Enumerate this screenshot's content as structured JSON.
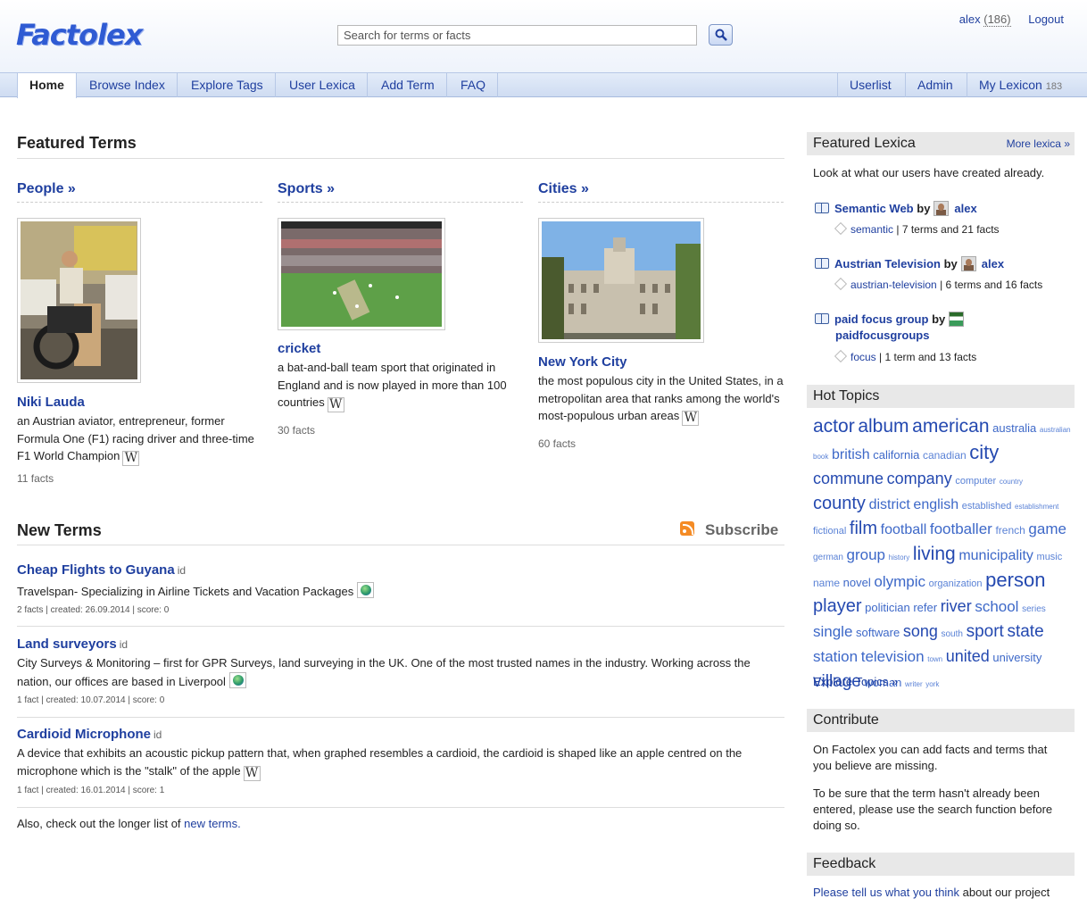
{
  "header": {
    "logo": "Factolex",
    "search_placeholder": "Search for terms or facts",
    "user": "alex",
    "user_count": "(186)",
    "logout": "Logout"
  },
  "tabs_left": [
    "Home",
    "Browse Index",
    "Explore Tags",
    "User Lexica",
    "Add Term",
    "FAQ"
  ],
  "tabs_right": {
    "userlist": "Userlist",
    "admin": "Admin",
    "my_lexicon": "My Lexicon",
    "my_lexicon_count": "183"
  },
  "featured": {
    "heading": "Featured Terms",
    "columns": [
      {
        "category": "People »",
        "term": "Niki Lauda",
        "desc": "an Austrian aviator, entrepreneur, former Formula One (F1) racing driver and three-time F1 World Champion",
        "facts": "11 facts"
      },
      {
        "category": "Sports »",
        "term": "cricket",
        "desc": "a bat-and-ball team sport that originated in England and is now played in more than 100 countries",
        "facts": "30 facts"
      },
      {
        "category": "Cities »",
        "term": "New York City",
        "desc": "the most populous city in the United States, in a metropolitan area that ranks among the world's most-populous urban areas",
        "facts": "60 facts"
      }
    ]
  },
  "new_terms": {
    "heading": "New Terms",
    "subscribe": "Subscribe",
    "id_label": "id",
    "items": [
      {
        "title": "Cheap Flights to Guyana",
        "desc": "Travelspan- Specializing in Airline Tickets and Vacation Packages",
        "meta": "2 facts | created: 26.09.2014 | score: 0"
      },
      {
        "title": "Land surveyors",
        "desc": "City Surveys & Monitoring – first for GPR Surveys, land surveying in the UK. One of the most trusted names in the industry. Working across the nation, our offices are based in Liverpool",
        "meta": "1 fact | created: 10.07.2014 | score: 0"
      },
      {
        "title": "Cardioid Microphone",
        "desc": "A device that exhibits an acoustic pickup pattern that, when graphed resembles a cardioid, the cardioid is shaped like an apple centred on the microphone which is the \"stalk\" of the apple",
        "meta": "1 fact | created: 16.01.2014 | score: 1"
      }
    ],
    "footer_text": "Also, check out the longer list of",
    "footer_link": "new terms."
  },
  "sidebar": {
    "featured_lexica": {
      "heading": "Featured Lexica",
      "more": "More lexica »",
      "intro": "Look at what our users have created already.",
      "by": "by",
      "items": [
        {
          "title": "Semantic Web",
          "user": "alex",
          "tag": "semantic",
          "stats": "| 7 terms and 21 facts"
        },
        {
          "title": "Austrian Television",
          "user": "alex",
          "tag": "austrian-television",
          "stats": "| 6 terms and 16 facts"
        },
        {
          "title": "paid focus group",
          "user": "paidfocusgroups",
          "tag": "focus",
          "stats": "| 1 term and 13 facts"
        }
      ]
    },
    "hot_topics": {
      "heading": "Hot Topics",
      "tags": [
        {
          "t": "actor",
          "s": 21
        },
        {
          "t": "album",
          "s": 21
        },
        {
          "t": "american",
          "s": 21
        },
        {
          "t": "australia",
          "s": 13
        },
        {
          "t": "australian",
          "s": 8
        },
        {
          "t": "book",
          "s": 8
        },
        {
          "t": "british",
          "s": 16
        },
        {
          "t": "california",
          "s": 13
        },
        {
          "t": "canadian",
          "s": 12
        },
        {
          "t": "city",
          "s": 22
        },
        {
          "t": "commune",
          "s": 18
        },
        {
          "t": "company",
          "s": 18
        },
        {
          "t": "computer",
          "s": 11
        },
        {
          "t": "country",
          "s": 8
        },
        {
          "t": "county",
          "s": 20
        },
        {
          "t": "district",
          "s": 16
        },
        {
          "t": "english",
          "s": 16
        },
        {
          "t": "established",
          "s": 11
        },
        {
          "t": "establishment",
          "s": 8
        },
        {
          "t": "fictional",
          "s": 11
        },
        {
          "t": "film",
          "s": 20
        },
        {
          "t": "football",
          "s": 16
        },
        {
          "t": "footballer",
          "s": 17
        },
        {
          "t": "french",
          "s": 12
        },
        {
          "t": "game",
          "s": 17
        },
        {
          "t": "german",
          "s": 10
        },
        {
          "t": "group",
          "s": 17
        },
        {
          "t": "history",
          "s": 8
        },
        {
          "t": "living",
          "s": 21
        },
        {
          "t": "municipality",
          "s": 16
        },
        {
          "t": "music",
          "s": 11
        },
        {
          "t": "name",
          "s": 12
        },
        {
          "t": "novel",
          "s": 13
        },
        {
          "t": "olympic",
          "s": 17
        },
        {
          "t": "organization",
          "s": 11
        },
        {
          "t": "person",
          "s": 22
        },
        {
          "t": "player",
          "s": 20
        },
        {
          "t": "politician",
          "s": 13
        },
        {
          "t": "refer",
          "s": 13
        },
        {
          "t": "river",
          "s": 18
        },
        {
          "t": "school",
          "s": 17
        },
        {
          "t": "series",
          "s": 10
        },
        {
          "t": "single",
          "s": 17
        },
        {
          "t": "software",
          "s": 13
        },
        {
          "t": "song",
          "s": 18
        },
        {
          "t": "south",
          "s": 10
        },
        {
          "t": "sport",
          "s": 19
        },
        {
          "t": "state",
          "s": 19
        },
        {
          "t": "station",
          "s": 17
        },
        {
          "t": "television",
          "s": 17
        },
        {
          "t": "town",
          "s": 8
        },
        {
          "t": "united",
          "s": 18
        },
        {
          "t": "university",
          "s": 13
        },
        {
          "t": "village",
          "s": 19
        },
        {
          "t": "woman",
          "s": 13
        },
        {
          "t": "writer",
          "s": 8
        },
        {
          "t": "york",
          "s": 8
        }
      ],
      "explore": "Explore Topics »"
    },
    "contribute": {
      "heading": "Contribute",
      "p1": "On Factolex you can add facts and terms that you believe are missing.",
      "p2": "To be sure that the term hasn't already been entered, please use the search function before doing so."
    },
    "feedback": {
      "heading": "Feedback",
      "link": "Please tell us what you think",
      "rest": "about our project"
    }
  },
  "colors": {
    "link": "#1f3f9f",
    "tag_cloud": "#2d57b8",
    "nav_bg": "#d8e3f5",
    "sidebar_header_bg": "#e8e8e8"
  }
}
